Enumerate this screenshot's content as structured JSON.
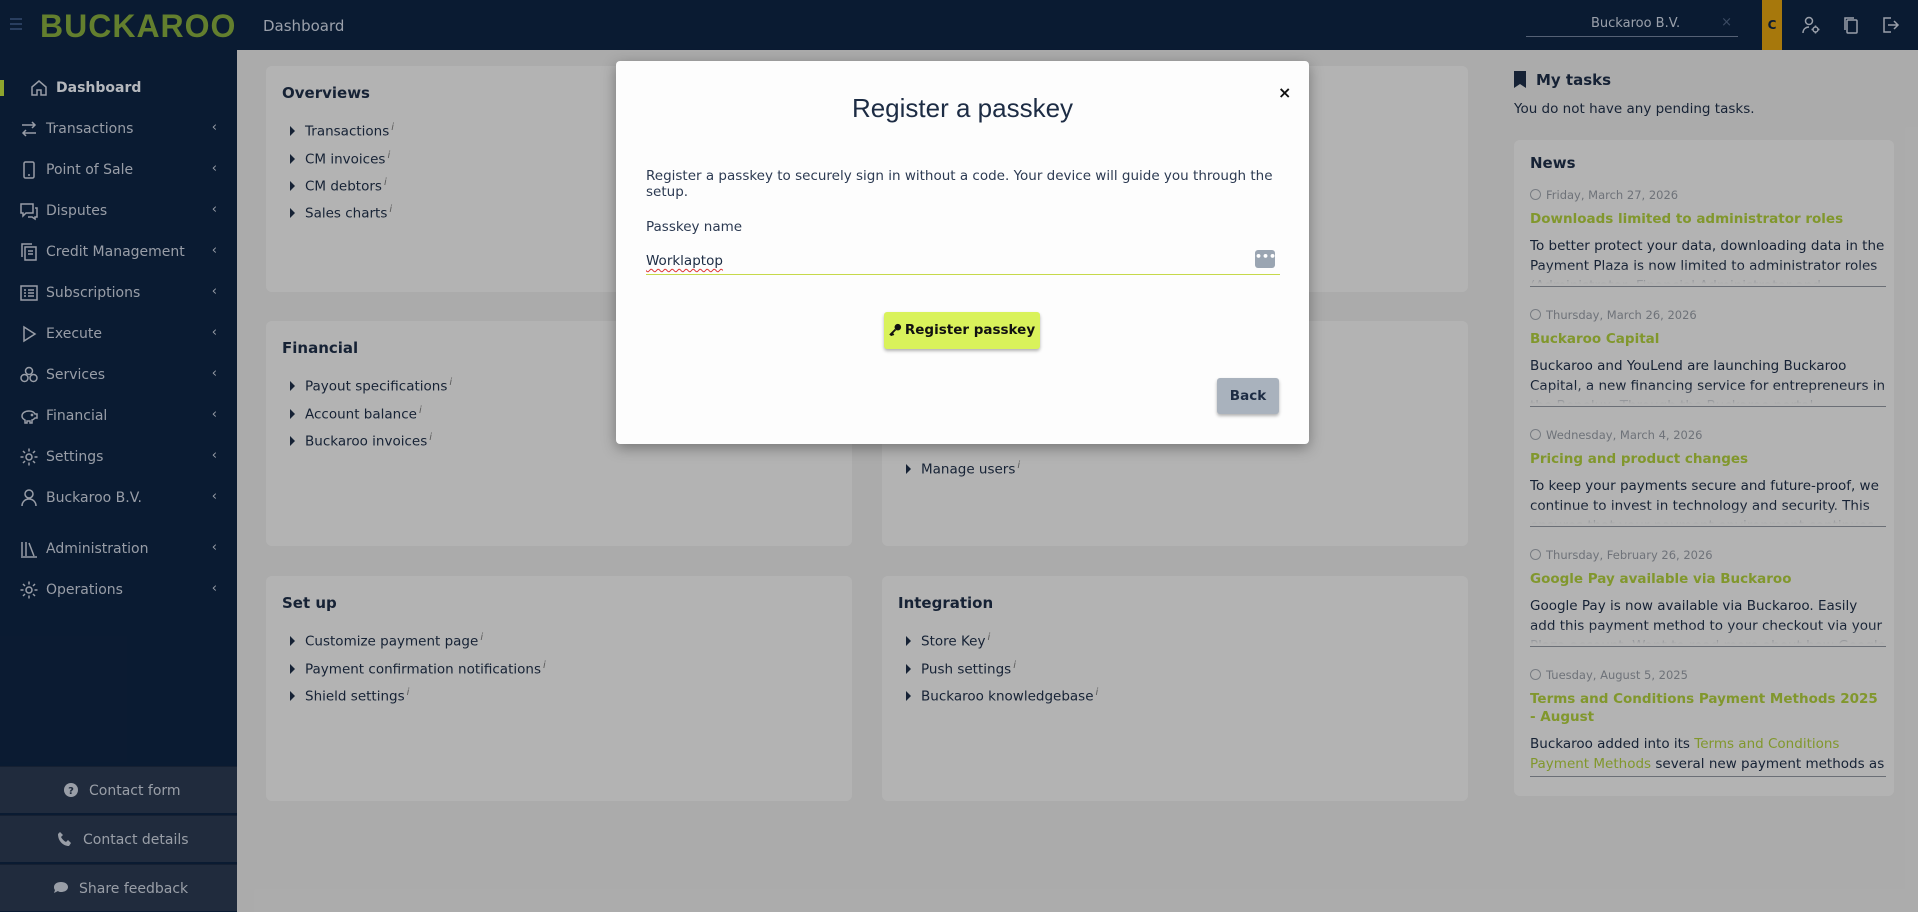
{
  "app": {
    "logo_text": "BUCKAROO",
    "page_title": "Dashboard",
    "organization": "Buckaroo B.V.",
    "organization_clear": "×",
    "avatar_initial": "C",
    "colors": {
      "navy": "#0e2340",
      "accent_green": "#b7d43a",
      "link_green": "#a6c23a",
      "avatar": "#d69a10"
    }
  },
  "sidebar": {
    "items": [
      {
        "label": "Dashboard",
        "icon": "home-icon",
        "active": true
      },
      {
        "label": "Transactions",
        "icon": "arrows-icon",
        "chevron": "‹"
      },
      {
        "label": "Point of Sale",
        "icon": "phone-icon",
        "chevron": "‹"
      },
      {
        "label": "Disputes",
        "icon": "chat-icon",
        "chevron": "‹"
      },
      {
        "label": "Credit Management",
        "icon": "documents-icon",
        "chevron": "‹"
      },
      {
        "label": "Subscriptions",
        "icon": "list-icon",
        "chevron": "‹"
      },
      {
        "label": "Execute",
        "icon": "play-icon",
        "chevron": "‹"
      },
      {
        "label": "Services",
        "icon": "services-icon",
        "chevron": "‹"
      },
      {
        "label": "Financial",
        "icon": "piggy-bank-icon",
        "chevron": "‹"
      },
      {
        "label": "Settings",
        "icon": "gear-icon",
        "chevron": "‹"
      },
      {
        "label": "Buckaroo B.V.",
        "icon": "user-icon",
        "chevron": "‹"
      },
      {
        "label": "Administration",
        "icon": "library-icon",
        "chevron": "‹"
      },
      {
        "label": "Operations",
        "icon": "gear-icon",
        "chevron": "‹"
      }
    ],
    "footer": [
      {
        "label": "Contact form",
        "icon": "question-icon"
      },
      {
        "label": "Contact details",
        "icon": "phone-handset-icon"
      },
      {
        "label": "Share feedback",
        "icon": "chat-bubble-icon"
      }
    ]
  },
  "cards": {
    "overviews": {
      "title": "Overviews",
      "links": [
        "Transactions",
        "CM invoices",
        "CM debtors",
        "Sales charts"
      ]
    },
    "financial": {
      "title": "Financial",
      "links": [
        "Payout specifications",
        "Account balance",
        "Buckaroo invoices"
      ]
    },
    "users": {
      "links": [
        "Manage users"
      ]
    },
    "setup": {
      "title": "Set up",
      "links": [
        "Customize payment page",
        "Payment confirmation notifications",
        "Shield settings"
      ]
    },
    "integration": {
      "title": "Integration",
      "links": [
        "Store Key",
        "Push settings",
        "Buckaroo knowledgebase"
      ]
    },
    "info_marker": "i"
  },
  "tasks": {
    "title": "My tasks",
    "empty": "You do not have any pending tasks."
  },
  "news": {
    "title": "News",
    "items": [
      {
        "date": "Friday, March 27, 2026",
        "headline": "Downloads limited to administrator roles",
        "body": "To better protect your data, downloading data in the Payment Plaza is now limited to administrator roles (Administrator, Financial Administrator and Technical"
      },
      {
        "date": "Thursday, March 26, 2026",
        "headline": "Buckaroo Capital",
        "body": "Buckaroo and YouLend are launching Buckaroo Capital, a new financing service for entrepreneurs in the Benelux. Through the Buckaroo portal,"
      },
      {
        "date": "Wednesday, March 4, 2026",
        "headline": "Pricing and product changes",
        "body": "To keep your payments secure and future-proof, we continue to invest in technology and security. This ensures that your payment environment continues to"
      },
      {
        "date": "Thursday, February 26, 2026",
        "headline": "Google Pay available via Buckaroo",
        "body": "Google Pay is now available via Buckaroo. Easily add this payment method to your checkout via your Plaza account. Want to read more about how Google Pay"
      },
      {
        "date": "Tuesday, August 5, 2025",
        "headline": "Terms and Conditions Payment Methods 2025 - August",
        "body_prefix": "Buckaroo added into its ",
        "body_link": "Terms and Conditions Payment Methods",
        "body_suffix": " several new payment methods as"
      }
    ]
  },
  "modal": {
    "title": "Register a passkey",
    "close": "×",
    "description": "Register a passkey to securely sign in without a code. Your device will guide you through the setup.",
    "field_label": "Passkey name",
    "field_value": "Worklaptop",
    "field_menu": "•••",
    "register_label": "Register passkey",
    "back_label": "Back"
  }
}
